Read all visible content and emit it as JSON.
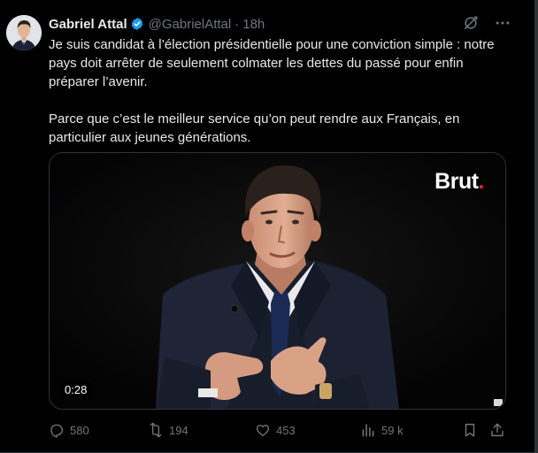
{
  "author": {
    "name": "Gabriel Attal",
    "handle": "@GabrielAttal",
    "separator": "·",
    "time": "18h",
    "verified": true
  },
  "tweet": {
    "paragraph1": "Je suis candidat à l’élection présidentielle pour une conviction simple : notre pays doit arrêter de seulement colmater les dettes du passé pour enfin préparer l’avenir.",
    "paragraph2": "Parce que c’est le meilleur service qu’on peut rendre aux Français, en particulier aux jeunes générations."
  },
  "media": {
    "brand_text": "Brut",
    "brand_dot": ".",
    "duration": "0:28"
  },
  "actions": {
    "replies": "580",
    "reposts": "194",
    "likes": "453",
    "views": "59 k"
  },
  "icons": {
    "grok": "grok-icon",
    "more": "more-icon",
    "reply": "reply-icon",
    "repost": "repost-icon",
    "like": "like-icon",
    "views": "views-icon",
    "bookmark": "bookmark-icon",
    "share": "share-icon",
    "verified": "verified-badge-icon"
  },
  "colors": {
    "background": "#000000",
    "text": "#e7e9ea",
    "muted": "#71767b",
    "verified_badge": "#1d9bf0",
    "brand_dot": "#e8262c"
  }
}
